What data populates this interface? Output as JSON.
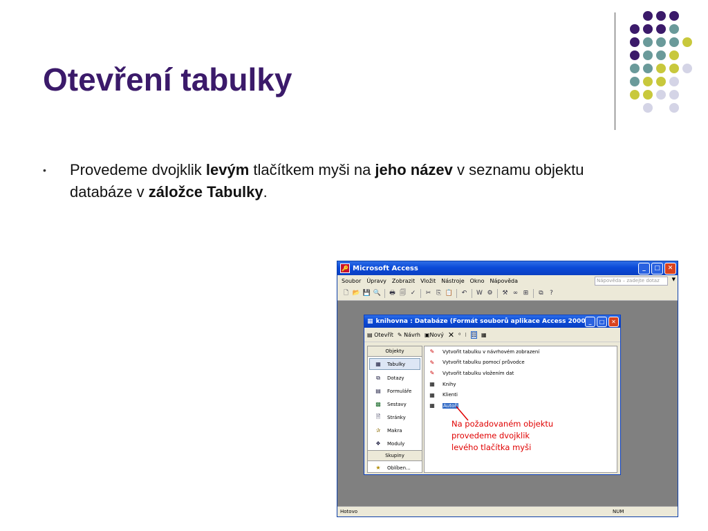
{
  "slide": {
    "title": "Otevření tabulky",
    "bullet_parts": [
      "Provedeme dvojklik ",
      "levým",
      " tlačítkem myši na ",
      "jeho název",
      " v seznamu objektu databáze v ",
      "záložce Tabulky",
      "."
    ]
  },
  "colors": {
    "title": "#3b1a6a",
    "dot_purple": "#3b1a6a",
    "dot_teal": "#6a9a9a",
    "dot_yellow": "#c8c83c",
    "dot_lavender": "#d4d4e6",
    "annotation": "#e00000"
  },
  "access": {
    "window_title": "Microsoft Access",
    "menu": [
      "Soubor",
      "Úpravy",
      "Zobrazit",
      "Vložit",
      "Nástroje",
      "Okno",
      "Nápověda"
    ],
    "help_placeholder": "Nápověda – zadejte dotaz",
    "status_left": "Hotovo",
    "status_right": "NUM",
    "toolbar_icons": [
      "new-icon",
      "open-icon",
      "save-icon",
      "search-icon",
      "print-icon",
      "preview-icon",
      "spell-icon",
      "cut-icon",
      "copy-icon",
      "paste-icon",
      "undo-icon",
      "officelinks-icon",
      "analyze-icon",
      "code-icon",
      "properties-icon",
      "relationships-icon",
      "new-object-icon",
      "help-icon"
    ]
  },
  "db_window": {
    "title": "knihovna : Databáze (Formát souborů aplikace Access 2000)",
    "toolbar": [
      "Otevřít",
      "Návrh",
      "Nový"
    ],
    "objects_header": "Objekty",
    "objects": [
      {
        "label": "Tabulky",
        "icon": "table-icon",
        "selected": true
      },
      {
        "label": "Dotazy",
        "icon": "query-icon"
      },
      {
        "label": "Formuláře",
        "icon": "form-icon"
      },
      {
        "label": "Sestavy",
        "icon": "report-icon"
      },
      {
        "label": "Stránky",
        "icon": "page-icon"
      },
      {
        "label": "Makra",
        "icon": "macro-icon"
      },
      {
        "label": "Moduly",
        "icon": "module-icon"
      }
    ],
    "groups_header": "Skupiny",
    "groups": [
      {
        "label": "Oblíben...",
        "icon": "favorites-icon"
      }
    ],
    "list": [
      {
        "label": "Vytvořit tabulku v návrhovém zobrazení",
        "icon": "wizard-icon"
      },
      {
        "label": "Vytvořit tabulku pomocí průvodce",
        "icon": "wizard-icon"
      },
      {
        "label": "Vytvořit tabulku vložením dat",
        "icon": "wizard-icon"
      },
      {
        "label": "Knihy",
        "icon": "table-icon"
      },
      {
        "label": "Klienti",
        "icon": "table-icon"
      },
      {
        "label": "Autoři",
        "icon": "table-icon",
        "selected": true
      }
    ]
  },
  "annotation": {
    "lines": [
      "Na požadovaném objektu",
      "provedeme dvojklik",
      "levého tlačítka myši"
    ]
  }
}
